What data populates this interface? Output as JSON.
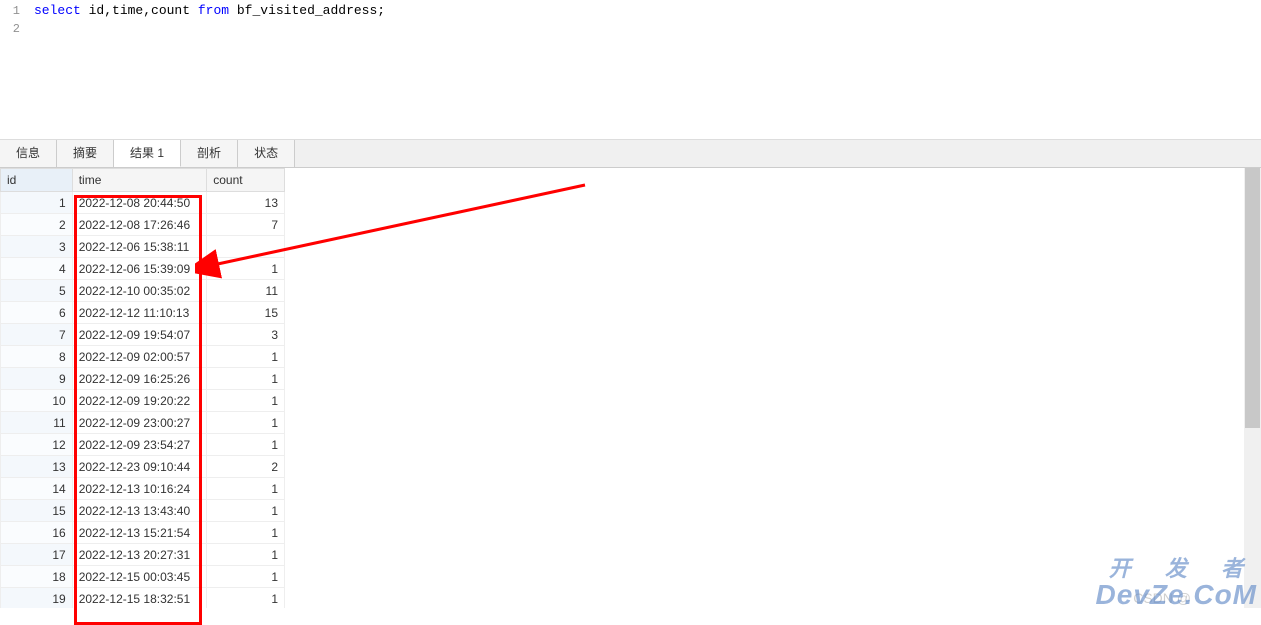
{
  "editor": {
    "lines": [
      {
        "num": "1",
        "segments": [
          {
            "t": "select",
            "cls": "kw-select"
          },
          {
            "t": " id,time,count ",
            "cls": "plain"
          },
          {
            "t": "from",
            "cls": "kw-from"
          },
          {
            "t": " bf_visited_address;",
            "cls": "plain"
          }
        ]
      },
      {
        "num": "2",
        "segments": []
      }
    ]
  },
  "tabs": [
    {
      "label": "信息",
      "active": false
    },
    {
      "label": "摘要",
      "active": false
    },
    {
      "label": "结果 1",
      "active": true
    },
    {
      "label": "剖析",
      "active": false
    },
    {
      "label": "状态",
      "active": false
    }
  ],
  "columns": {
    "id": "id",
    "time": "time",
    "count": "count"
  },
  "rows": [
    {
      "id": "1",
      "time": "2022-12-08 20:44:50",
      "count": "13"
    },
    {
      "id": "2",
      "time": "2022-12-08 17:26:46",
      "count": "7"
    },
    {
      "id": "3",
      "time": "2022-12-06 15:38:11",
      "count": ""
    },
    {
      "id": "4",
      "time": "2022-12-06 15:39:09",
      "count": "1"
    },
    {
      "id": "5",
      "time": "2022-12-10 00:35:02",
      "count": "11"
    },
    {
      "id": "6",
      "time": "2022-12-12 11:10:13",
      "count": "15"
    },
    {
      "id": "7",
      "time": "2022-12-09 19:54:07",
      "count": "3"
    },
    {
      "id": "8",
      "time": "2022-12-09 02:00:57",
      "count": "1"
    },
    {
      "id": "9",
      "time": "2022-12-09 16:25:26",
      "count": "1"
    },
    {
      "id": "10",
      "time": "2022-12-09 19:20:22",
      "count": "1"
    },
    {
      "id": "11",
      "time": "2022-12-09 23:00:27",
      "count": "1"
    },
    {
      "id": "12",
      "time": "2022-12-09 23:54:27",
      "count": "1"
    },
    {
      "id": "13",
      "time": "2022-12-23 09:10:44",
      "count": "2"
    },
    {
      "id": "14",
      "time": "2022-12-13 10:16:24",
      "count": "1"
    },
    {
      "id": "15",
      "time": "2022-12-13 13:43:40",
      "count": "1"
    },
    {
      "id": "16",
      "time": "2022-12-13 15:21:54",
      "count": "1"
    },
    {
      "id": "17",
      "time": "2022-12-13 20:27:31",
      "count": "1"
    },
    {
      "id": "18",
      "time": "2022-12-15 00:03:45",
      "count": "1"
    },
    {
      "id": "19",
      "time": "2022-12-15 18:32:51",
      "count": "1"
    }
  ],
  "watermark": {
    "csdn": "CSDN @",
    "devze_top": "开 发 者",
    "devze_bottom": "DevZe.CoM"
  }
}
